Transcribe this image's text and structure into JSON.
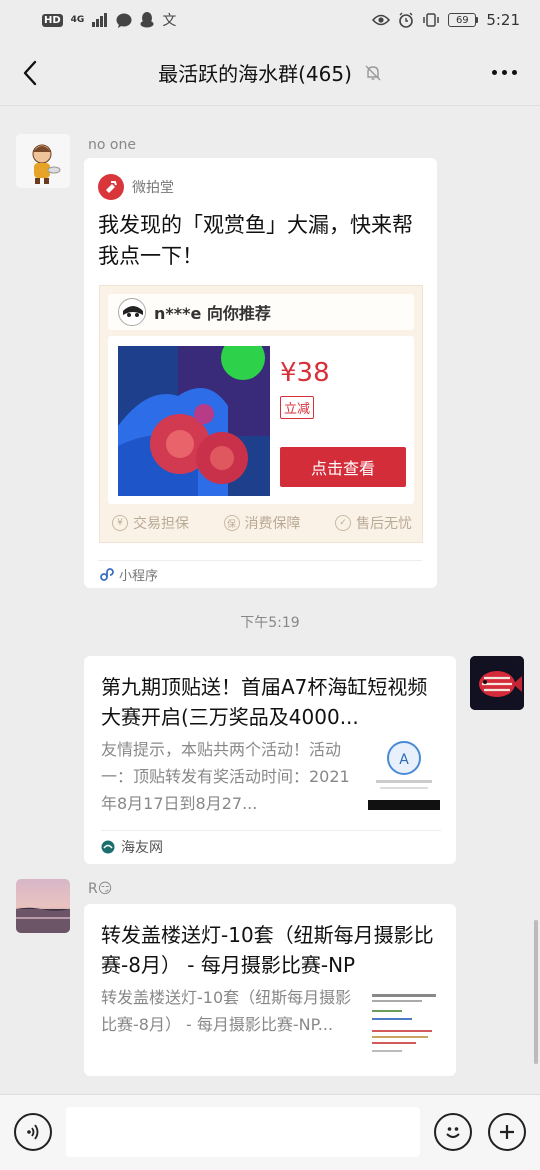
{
  "status_bar": {
    "hd_label": "HD",
    "network_label": "4G",
    "battery_level": "69",
    "time": "5:21"
  },
  "header": {
    "title": "最活跃的海水群(465)"
  },
  "messages": {
    "msg1": {
      "sender": "no one",
      "source_name": "微拍堂",
      "title": "我发现的「观赏鱼」大漏，快来帮我点一下！",
      "preview": {
        "recommender": "n***e 向你推荐",
        "price": "¥38",
        "tag": "立减",
        "button": "点击查看",
        "footer": [
          "交易担保",
          "消费保障",
          "售后无忧"
        ]
      },
      "footer_label": "小程序"
    },
    "timestamp": "下午5:19",
    "msg2": {
      "title": "第九期顶贴送！首届A7杯海缸短视频大赛开启(三万奖品及4000...",
      "description": "友情提示，本贴共两个活动！活动一：顶贴转发有奖活动时间：2021年8月17日到8月27...",
      "source": "海友网"
    },
    "msg3": {
      "sender": "R😏",
      "title": "转发盖楼送灯-10套（纽斯每月摄影比赛-8月） - 每月摄影比赛-NP",
      "description": "转发盖楼送灯-10套（纽斯每月摄影比赛-8月） - 每月摄影比赛-NP..."
    }
  },
  "input_bar": {
    "placeholder": ""
  },
  "colors": {
    "accent_red": "#d42d3a",
    "background": "#ededed"
  }
}
